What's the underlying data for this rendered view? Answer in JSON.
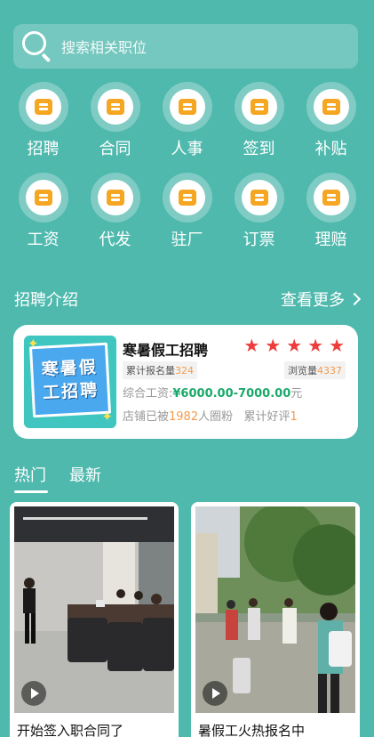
{
  "search": {
    "placeholder": "搜索相关职位"
  },
  "grid": [
    {
      "label": "招聘",
      "icon": "handshake-icon"
    },
    {
      "label": "合同",
      "icon": "document-icon"
    },
    {
      "label": "人事",
      "icon": "oa-icon"
    },
    {
      "label": "签到",
      "icon": "clock-icon"
    },
    {
      "label": "补贴",
      "icon": "ticket-icon"
    },
    {
      "label": "工资",
      "icon": "worker-icon"
    },
    {
      "label": "代发",
      "icon": "money-bag-icon"
    },
    {
      "label": "驻厂",
      "icon": "factory-icon"
    },
    {
      "label": "订票",
      "icon": "ticket-icon"
    },
    {
      "label": "理赔",
      "icon": "hand-coin-icon"
    }
  ],
  "section": {
    "title": "招聘介绍",
    "more": "查看更多"
  },
  "job": {
    "poster_text": "寒暑假工招聘",
    "title": "寒暑假工招聘",
    "stars": 5,
    "signup_label": "累计报名量",
    "signup_count": "324",
    "views_label": "浏览量",
    "views_count": "4337",
    "salary_label": "综合工资:",
    "salary_amount": "¥6000.00-7000.00",
    "salary_unit": "元",
    "fans_prefix": "店铺已被",
    "fans_count": "1982",
    "fans_suffix": "人圈粉",
    "rating_label": "累计好评",
    "rating_count": "1"
  },
  "tabs": [
    {
      "label": "热门",
      "active": true
    },
    {
      "label": "最新",
      "active": false
    }
  ],
  "posts": [
    {
      "title": "开始签入职合同了"
    },
    {
      "title": "暑假工火热报名中"
    }
  ],
  "colors": {
    "background": "#4fb9ae",
    "accent_orange": "#f39b4b",
    "star_red": "#ee3b3b",
    "salary_green": "#1aa96a"
  }
}
